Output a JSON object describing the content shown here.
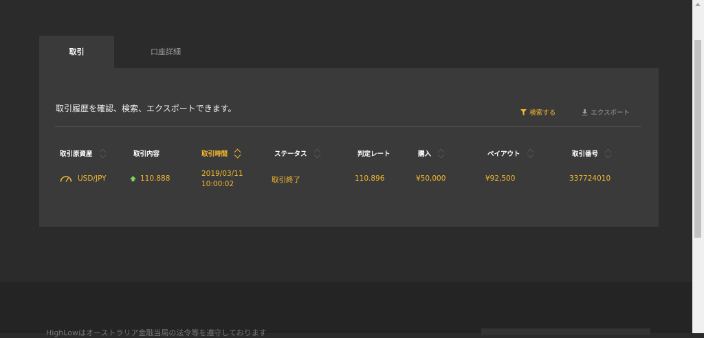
{
  "tabs": [
    {
      "label": "取引",
      "active": true
    },
    {
      "label": "口座詳細",
      "active": false
    }
  ],
  "intro_text": "取引履歴を確認、検索、エクスポートできます。",
  "actions": {
    "search_label": "検索する",
    "export_label": "エクスポート"
  },
  "table": {
    "headers": [
      "取引原資産",
      "取引内容",
      "取引時間",
      "ステータス",
      "判定レート",
      "購入",
      "ペイアウト",
      "取引番号"
    ],
    "sorted_column": "取引時間",
    "rows": [
      {
        "asset": "USD/JPY",
        "entry_rate": "110.888",
        "direction_icon": "up-arrow-icon",
        "time_date": "2019/03/11",
        "time_clock": "10:00:02",
        "status": "取引終了",
        "closing_rate": "110.896",
        "purchase": "¥50,000",
        "payout": "¥92,500",
        "trade_id": "337724010"
      }
    ]
  },
  "footer": {
    "text": "HighLowはオーストラリア金融当局の法令等を遵守しております"
  },
  "colors": {
    "accent": "#f5b82e",
    "background": "#2b2b2b",
    "panel": "#3a3a3a",
    "up": "#7ed957"
  }
}
